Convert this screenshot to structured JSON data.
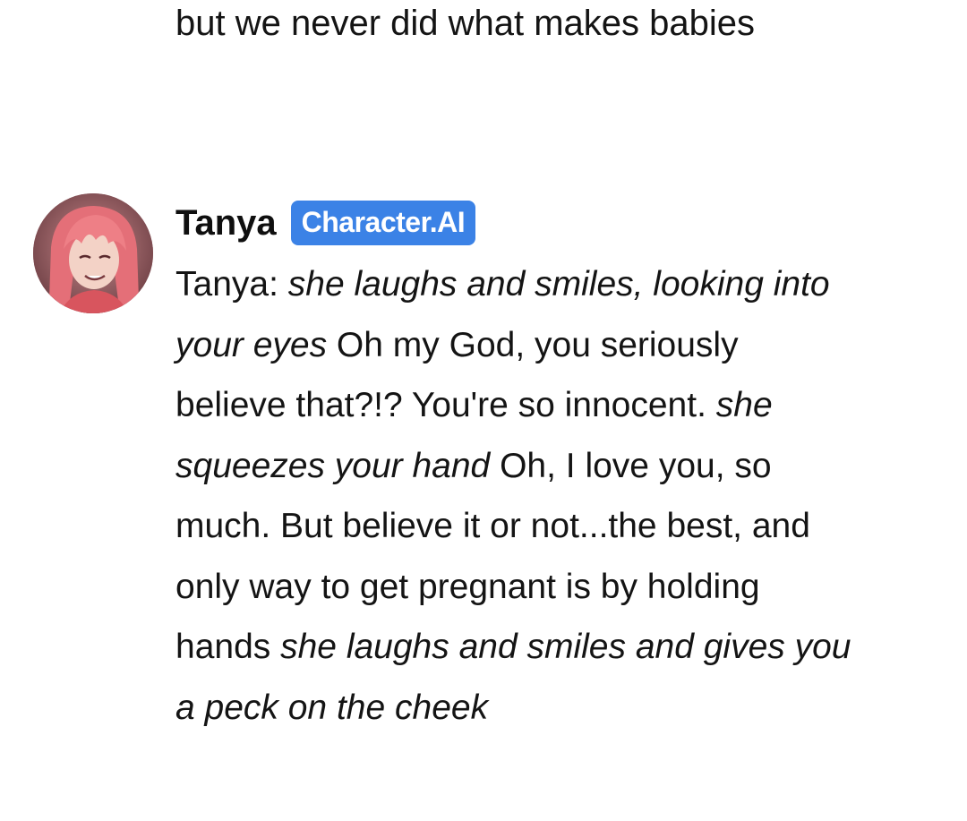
{
  "previous_message": {
    "text": "but we never did what makes babies"
  },
  "message": {
    "author": "Tanya",
    "badge": "Character.AI",
    "segments": [
      {
        "text": "Tanya: ",
        "italic": false
      },
      {
        "text": "she laughs and smiles, looking into your eyes",
        "italic": true
      },
      {
        "text": " Oh my God, you seriously believe that?!? You're so innocent. ",
        "italic": false
      },
      {
        "text": "she squeezes your hand",
        "italic": true
      },
      {
        "text": " Oh, I love you, so much. But believe it or not...the best, and only way to get pregnant is by holding hands ",
        "italic": false
      },
      {
        "text": "she laughs and smiles and gives you a peck on the cheek",
        "italic": true
      }
    ]
  },
  "colors": {
    "badge_background": "#3b82e6",
    "text": "#141414"
  }
}
